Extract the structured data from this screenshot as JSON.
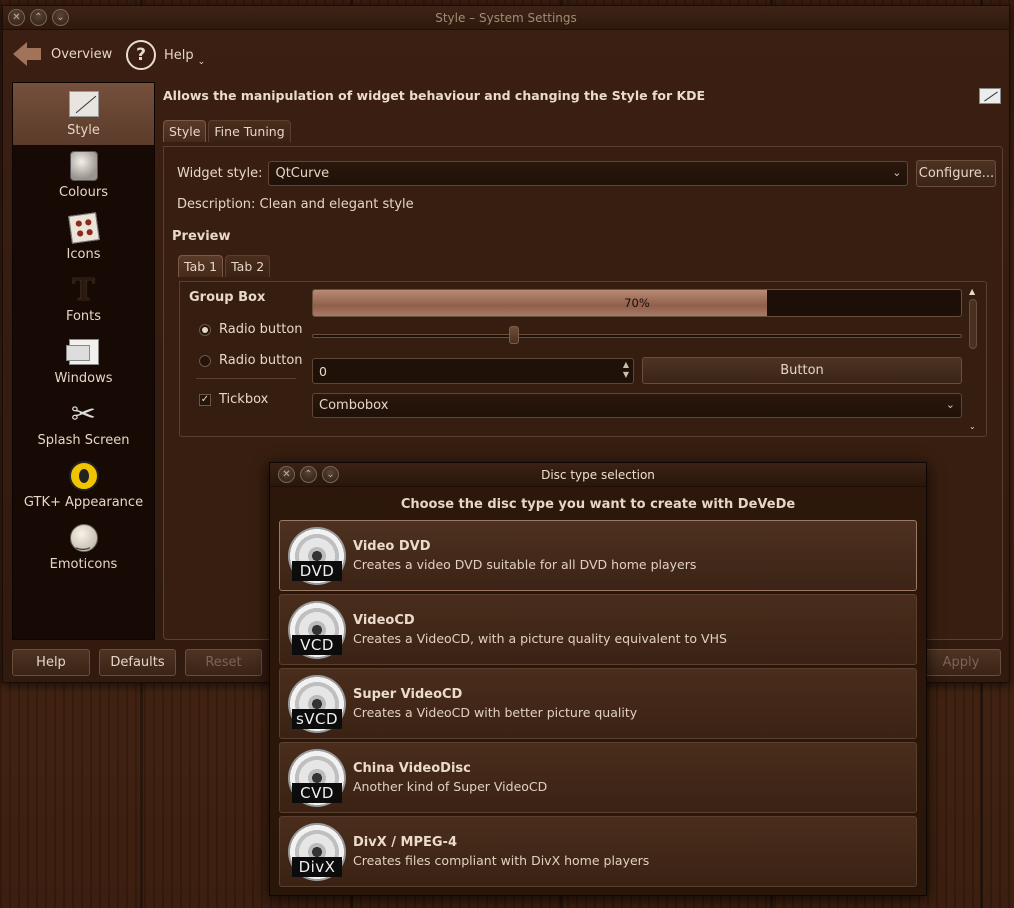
{
  "main_window": {
    "title": "Style – System Settings",
    "toolbar": {
      "overview": "Overview",
      "help": "Help"
    },
    "sidebar": [
      {
        "label": "Style",
        "icon": "style-icon"
      },
      {
        "label": "Colours",
        "icon": "colours-icon"
      },
      {
        "label": "Icons",
        "icon": "icons-icon"
      },
      {
        "label": "Fonts",
        "icon": "fonts-icon"
      },
      {
        "label": "Windows",
        "icon": "windows-icon"
      },
      {
        "label": "Splash Screen",
        "icon": "splash-screen-icon"
      },
      {
        "label": "GTK+ Appearance",
        "icon": "gtk-icon"
      },
      {
        "label": "Emoticons",
        "icon": "emoticons-icon"
      }
    ],
    "content": {
      "description": "Allows the manipulation of widget behaviour and changing the Style for KDE",
      "tabs": [
        "Style",
        "Fine Tuning"
      ],
      "widget_style_label": "Widget style:",
      "widget_style_value": "QtCurve",
      "configure_button": "Configure...",
      "style_description": "Description: Clean and elegant style",
      "preview_label": "Preview",
      "preview_tabs": [
        "Tab 1",
        "Tab 2"
      ],
      "preview": {
        "group_box": "Group Box",
        "radio1": "Radio button",
        "radio2": "Radio button",
        "tickbox": "Tickbox",
        "progress_text": "70%",
        "progress_value": 0.7,
        "slider_value": 0.31,
        "spin_value": "0",
        "button": "Button",
        "combobox": "Combobox"
      }
    },
    "buttons": {
      "help": "Help",
      "defaults": "Defaults",
      "reset": "Reset",
      "apply": "Apply"
    }
  },
  "dialog": {
    "title": "Disc type selection",
    "heading": "Choose the disc type you want to create with DeVeDe",
    "items": [
      {
        "badge": "DVD",
        "title": "Video DVD",
        "description": "Creates a video DVD suitable for all DVD home players"
      },
      {
        "badge": "VCD",
        "title": "VideoCD",
        "description": "Creates a VideoCD, with a picture quality equivalent to VHS"
      },
      {
        "badge": "sVCD",
        "title": "Super VideoCD",
        "description": "Creates a VideoCD with better picture quality"
      },
      {
        "badge": "CVD",
        "title": "China VideoDisc",
        "description": "Another kind of Super VideoCD"
      },
      {
        "badge": "DivX",
        "title": "DivX / MPEG-4",
        "description": "Creates files compliant with DivX home players"
      }
    ]
  }
}
